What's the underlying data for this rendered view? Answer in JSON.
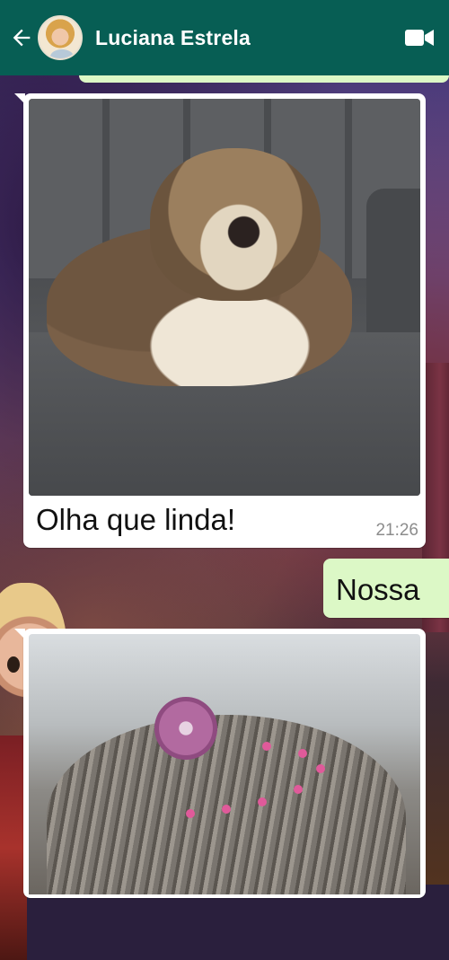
{
  "header": {
    "back_icon": "arrow-left-icon",
    "contact_name": "Luciana Estrela",
    "video_icon": "video-camera-icon",
    "bar_color": "#075e54"
  },
  "messages": [
    {
      "direction": "incoming",
      "type": "image",
      "image_subject": "dog on sofa",
      "caption": "Olha que linda!",
      "time": "21:26"
    },
    {
      "direction": "outgoing",
      "type": "text",
      "text": "Nossa"
    },
    {
      "direction": "incoming",
      "type": "image",
      "image_subject": "dog hair with pink bow"
    }
  ],
  "colors": {
    "incoming_bubble": "#ffffff",
    "outgoing_bubble": "#dcf8c6",
    "timestamp": "#8c8c8c"
  }
}
